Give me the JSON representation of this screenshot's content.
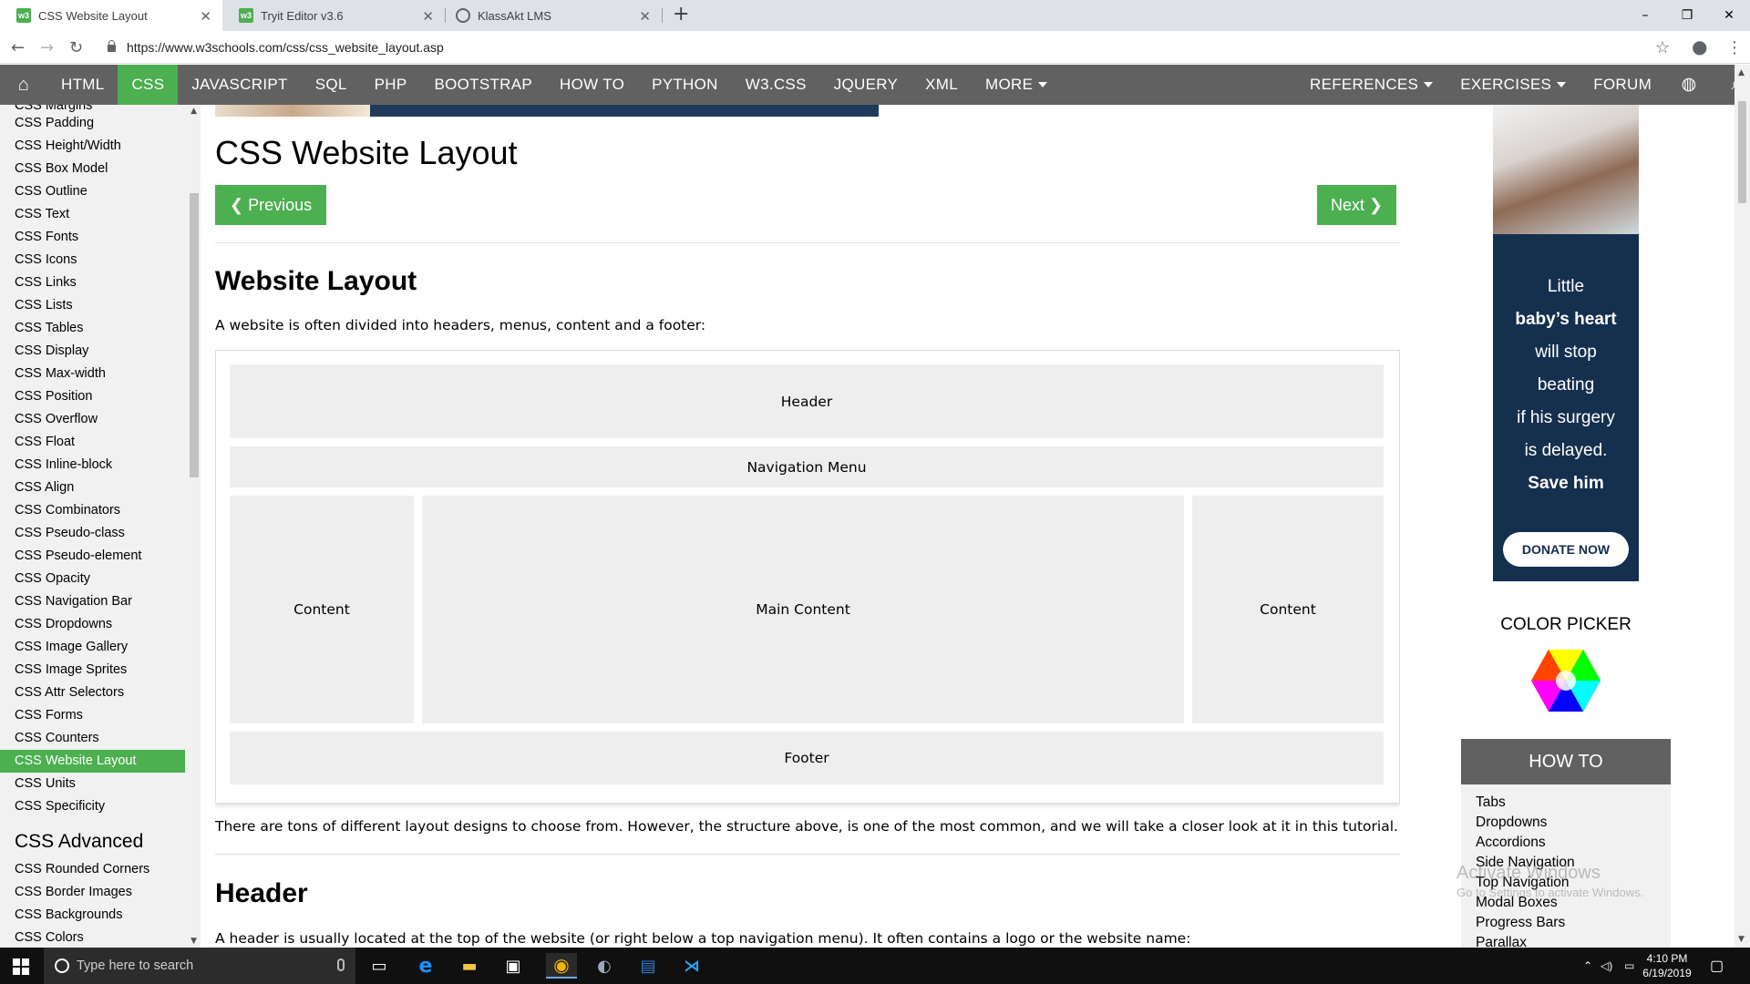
{
  "browser": {
    "tabs": [
      {
        "title": "CSS Website Layout",
        "active": true
      },
      {
        "title": "Tryit Editor v3.6",
        "active": false
      },
      {
        "title": "KlassAkt LMS",
        "active": false
      }
    ],
    "new_tab": "+",
    "url": "https://www.w3schools.com/css/css_website_layout.asp",
    "window_controls": {
      "minimize": "–",
      "maximize": "❐",
      "close": "✕"
    }
  },
  "topnav": {
    "items": [
      "HTML",
      "CSS",
      "JAVASCRIPT",
      "SQL",
      "PHP",
      "BOOTSTRAP",
      "HOW TO",
      "PYTHON",
      "W3.CSS",
      "JQUERY",
      "XML",
      "MORE"
    ],
    "active": "CSS",
    "right_items": [
      "REFERENCES",
      "EXERCISES",
      "FORUM"
    ]
  },
  "sidebar": {
    "partial_top": "CSS Margins",
    "links": [
      "CSS Padding",
      "CSS Height/Width",
      "CSS Box Model",
      "CSS Outline",
      "CSS Text",
      "CSS Fonts",
      "CSS Icons",
      "CSS Links",
      "CSS Lists",
      "CSS Tables",
      "CSS Display",
      "CSS Max-width",
      "CSS Position",
      "CSS Overflow",
      "CSS Float",
      "CSS Inline-block",
      "CSS Align",
      "CSS Combinators",
      "CSS Pseudo-class",
      "CSS Pseudo-element",
      "CSS Opacity",
      "CSS Navigation Bar",
      "CSS Dropdowns",
      "CSS Image Gallery",
      "CSS Image Sprites",
      "CSS Attr Selectors",
      "CSS Forms",
      "CSS Counters",
      "CSS Website Layout",
      "CSS Units",
      "CSS Specificity"
    ],
    "active": "CSS Website Layout",
    "section": "CSS Advanced",
    "advanced_links": [
      "CSS Rounded Corners",
      "CSS Border Images",
      "CSS Backgrounds",
      "CSS Colors"
    ]
  },
  "main": {
    "title": "CSS Website Layout",
    "prev_label": "❮ Previous",
    "next_label": "Next ❯",
    "section1_title": "Website Layout",
    "intro": "A website is often divided into headers, menus, content and a footer:",
    "layout": {
      "header": "Header",
      "nav": "Navigation Menu",
      "left": "Content",
      "main": "Main Content",
      "right": "Content",
      "footer": "Footer"
    },
    "after_text": "There are tons of different layout designs to choose from. However, the structure above, is one of the most common, and we will take a closer look at it in this tutorial.",
    "section2_title": "Header",
    "header_text": "A header is usually located at the top of the website (or right below a top navigation menu). It often contains a logo or the website name:"
  },
  "ad": {
    "lines": [
      "Little",
      "baby’s heart",
      "will stop",
      "beating",
      "if his surgery",
      "is delayed.",
      "Save him"
    ],
    "button": "DONATE NOW"
  },
  "color_picker": {
    "title": "COLOR PICKER"
  },
  "howto": {
    "title": "HOW TO",
    "items": [
      "Tabs",
      "Dropdowns",
      "Accordions",
      "Side Navigation",
      "Top Navigation",
      "Modal Boxes",
      "Progress Bars",
      "Parallax"
    ]
  },
  "watermark": {
    "line1": "Activate Windows",
    "line2": "Go to Settings to activate Windows."
  },
  "taskbar": {
    "search_placeholder": "Type here to search",
    "time": "4:10 PM",
    "date": "6/19/2019"
  },
  "colors": {
    "accent": "#4caf50",
    "nav": "#616161",
    "ad_bg": "#152f4e"
  }
}
